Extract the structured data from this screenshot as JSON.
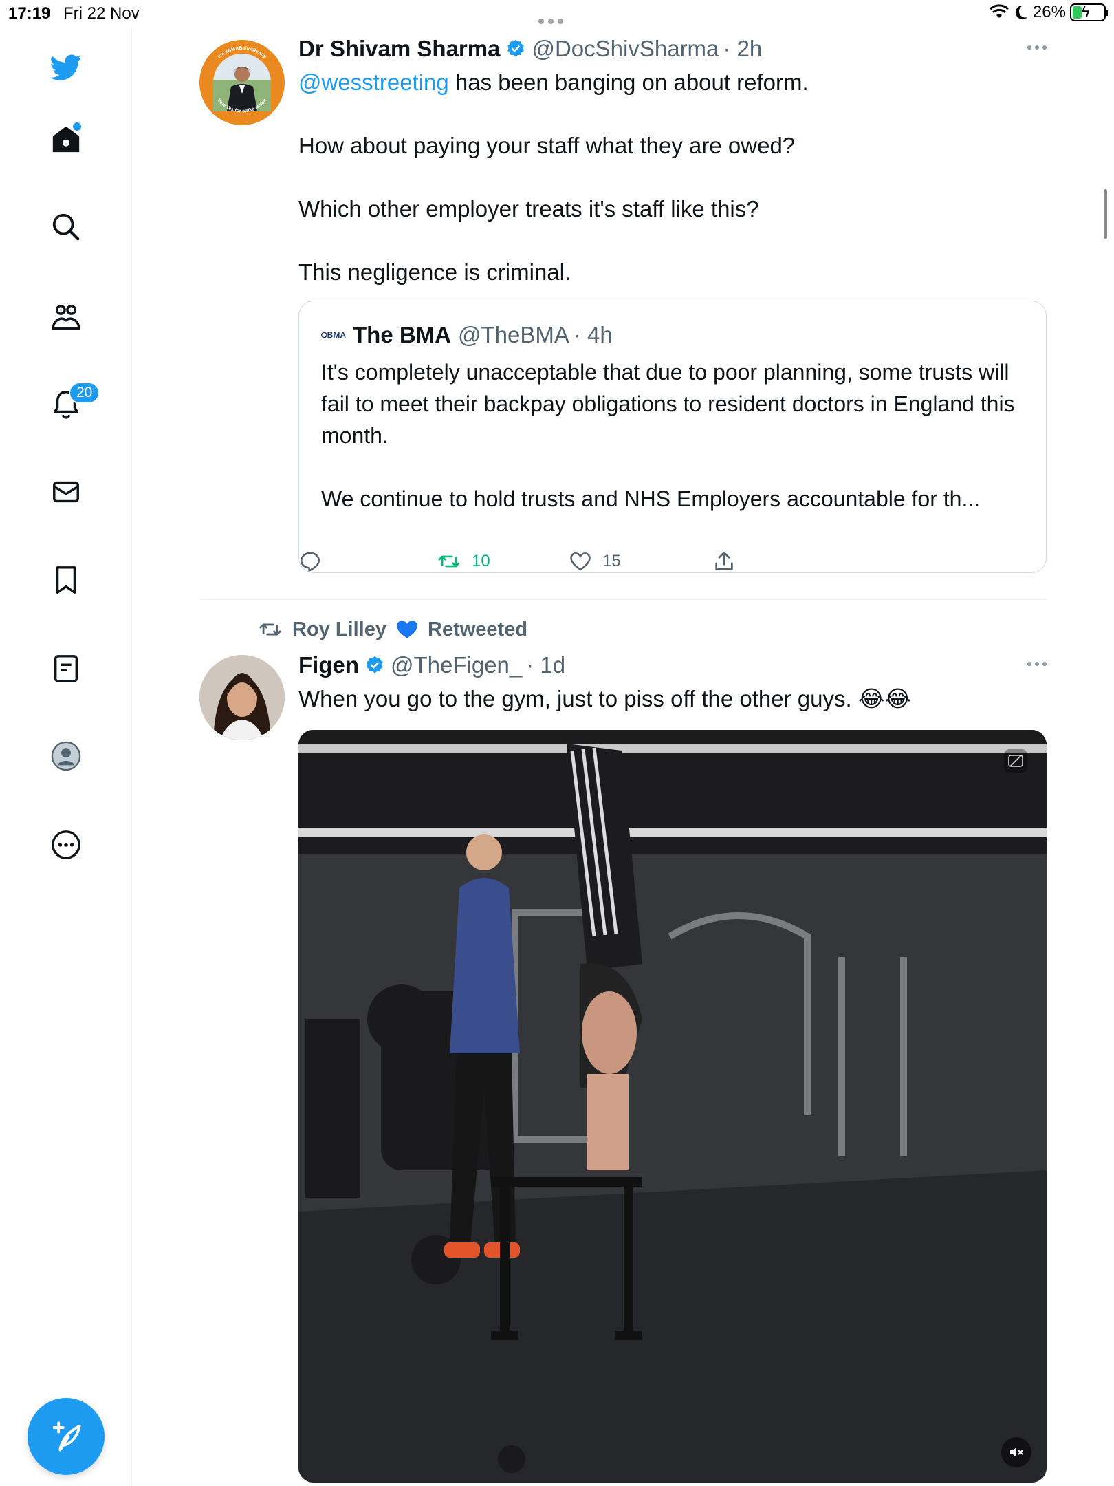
{
  "status_bar": {
    "time": "17:19",
    "date": "Fri 22 Nov",
    "battery": "26%"
  },
  "sidebar": {
    "notifications_badge": "20",
    "items": [
      "twitter-logo",
      "home-icon",
      "search-icon",
      "communities-icon",
      "notifications-icon",
      "messages-icon",
      "bookmarks-icon",
      "lists-icon",
      "profile-icon",
      "more-icon"
    ]
  },
  "tweets": [
    {
      "name": "Dr Shivam Sharma",
      "handle": "@DocShivSharma",
      "time": "· 2h",
      "mention": "@wesstreeting",
      "line1_rest": " has been banging on about reform.",
      "line2": "How about paying your staff what they are owed?",
      "line3": "Which other employer treats it's staff like this?",
      "line4": "This negligence is criminal.",
      "avatar_text_top": "I'm #BMABallotReady",
      "avatar_text_bottom": "Vote Yes for strike action",
      "quote": {
        "logo": "BMA",
        "name": "The BMA",
        "handle": "@TheBMA",
        "time": "· 4h",
        "para1": "It's completely unacceptable that due to poor planning, some trusts will fail to meet their backpay obligations to resident doctors in England this month.",
        "para2": "We continue to hold trusts and NHS Employers accountable for th..."
      },
      "retweets": "10",
      "likes": "15"
    },
    {
      "retweeted_by": "Roy Lilley",
      "retweeted_label": "Retweeted",
      "name": "Figen",
      "handle": "@TheFigen_",
      "time": "· 1d",
      "text": "When you go to the gym, just to piss off the other guys. 😂😂"
    }
  ],
  "colors": {
    "accent": "#1d9bf0",
    "retweet_green": "#00ba7c",
    "secondary_text": "#536471"
  }
}
